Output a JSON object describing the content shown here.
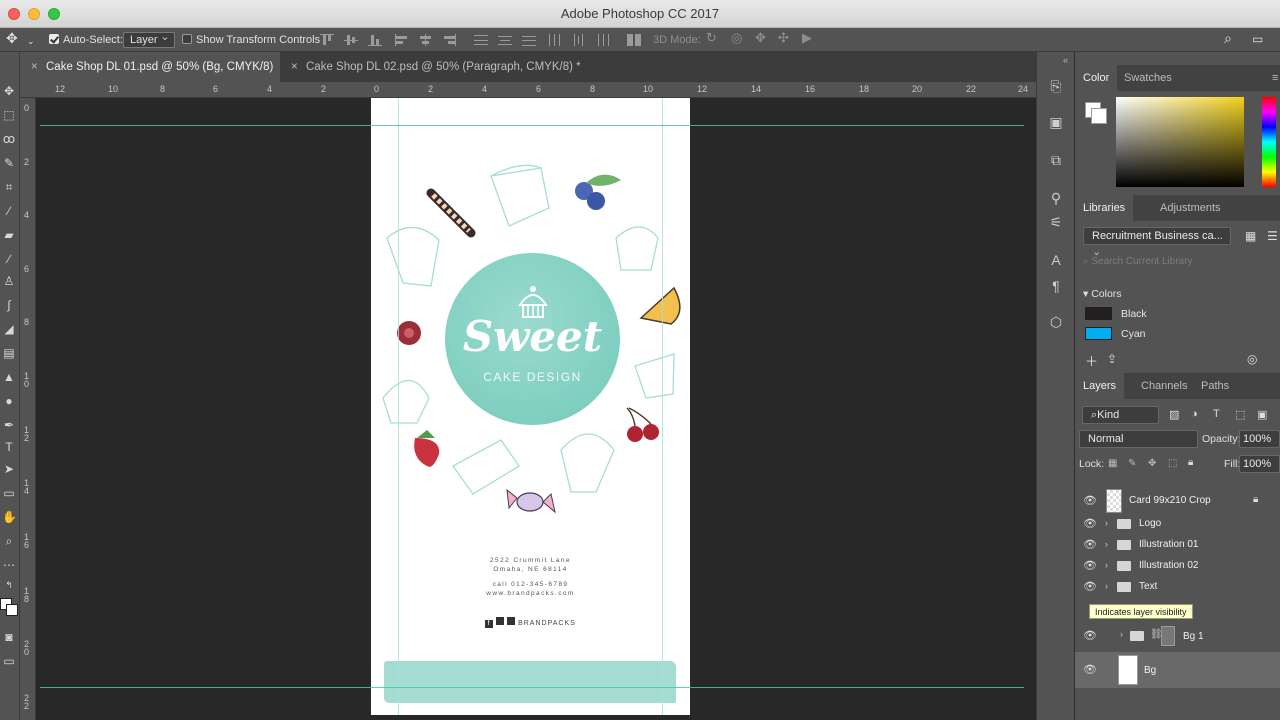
{
  "window": {
    "title": "Adobe Photoshop CC 2017"
  },
  "options": {
    "auto_select_label": "Auto-Select:",
    "auto_select_value": "Layer",
    "show_transform_label": "Show Transform Controls",
    "three_d_label": "3D Mode:"
  },
  "tabs": [
    {
      "label": "Cake Shop DL 01.psd @ 50% (Bg, CMYK/8) *"
    },
    {
      "label": "Cake Shop DL 02.psd @ 50% (Paragraph, CMYK/8) *"
    }
  ],
  "ruler": {
    "top": [
      "12",
      "10",
      "8",
      "6",
      "4",
      "2",
      "0",
      "2",
      "4",
      "6",
      "8",
      "10",
      "12",
      "14",
      "16",
      "18",
      "20",
      "22",
      "24"
    ],
    "left": [
      "0",
      "2",
      "4",
      "6",
      "8",
      "1\n0",
      "1\n2",
      "1\n4",
      "1\n6",
      "1\n8",
      "2\n0",
      "2\n2"
    ]
  },
  "document": {
    "title_script": "Sweet",
    "subtitle": "CAKE DESIGN",
    "address1": "2522 Crummit Lane",
    "address2": "Omaha, NE 68114",
    "phone": "call 012-345-6789",
    "web": "www.brandpacks.com",
    "brand": "BRANDPACKS"
  },
  "panels": {
    "color_tab": "Color",
    "swatches_tab": "Swatches",
    "libraries_tab": "Libraries",
    "adjustments_tab": "Adjustments",
    "library_select": "Recruitment Business ca...",
    "search_placeholder": "Search Current Library",
    "colors_section": "Colors",
    "colors": [
      {
        "name": "Black",
        "hex": "#231f20"
      },
      {
        "name": "Cyan",
        "hex": "#00aeef"
      }
    ],
    "layers_tab": "Layers",
    "channels_tab": "Channels",
    "paths_tab": "Paths",
    "kind_select": "Kind",
    "blend_mode": "Normal",
    "opacity_label": "Opacity:",
    "opacity_value": "100%",
    "lock_label": "Lock:",
    "fill_label": "Fill:",
    "fill_value": "100%"
  },
  "layers": [
    {
      "name": "Card 99x210 Crop"
    },
    {
      "name": "Logo"
    },
    {
      "name": "Illustration 01"
    },
    {
      "name": "Illustration 02"
    },
    {
      "name": "Text"
    },
    {
      "name": "Bg 1"
    },
    {
      "name": "Bg"
    }
  ],
  "tooltip": "Indicates layer visibility",
  "colors": {
    "accent": "#7fcfc1",
    "guide": "#41c8b0"
  }
}
